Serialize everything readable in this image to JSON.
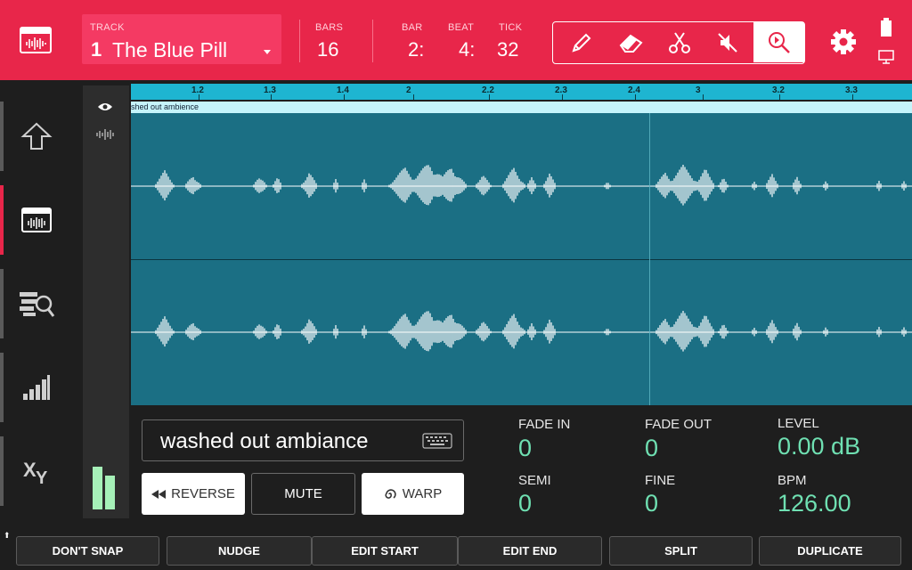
{
  "header": {
    "track_label": "TRACK",
    "track_number": "1",
    "track_name": "The Blue Pill",
    "bars_label": "BARS",
    "bars_value": "16",
    "bar_label": "BAR",
    "bar_value": "2:",
    "beat_label": "BEAT",
    "beat_value": "4:",
    "tick_label": "TICK",
    "tick_value": "32",
    "tools": [
      "pencil-icon",
      "eraser-icon",
      "scissors-icon",
      "mute-icon",
      "zoom-icon"
    ],
    "active_tool": "zoom-icon"
  },
  "sidebar": {
    "items": [
      "up-arrow-icon",
      "audio-edit-icon",
      "browser-search-icon",
      "level-bars-icon",
      "xy-icon"
    ],
    "active": "audio-edit-icon"
  },
  "timeline": {
    "ticks": [
      "1.2",
      "1.3",
      "1.4",
      "2",
      "2.2",
      "2.3",
      "2.4",
      "3",
      "3.2",
      "3.3"
    ],
    "region_label": "shed out ambience"
  },
  "region": {
    "name": "washed out ambiance"
  },
  "buttons": {
    "reverse": "REVERSE",
    "mute": "MUTE",
    "warp": "WARP"
  },
  "params": {
    "fade_in_label": "FADE IN",
    "fade_in_value": "0",
    "fade_out_label": "FADE OUT",
    "fade_out_value": "0",
    "level_label": "LEVEL",
    "level_value": "0.00 dB",
    "semi_label": "SEMI",
    "semi_value": "0",
    "fine_label": "FINE",
    "fine_value": "0",
    "bpm_label": "BPM",
    "bpm_value": "126.00"
  },
  "footer": {
    "dont_snap": "DON'T SNAP",
    "nudge": "NUDGE",
    "edit_start": "EDIT START",
    "edit_end": "EDIT END",
    "split": "SPLIT",
    "duplicate": "DUPLICATE"
  },
  "colors": {
    "topbar": "#e8264a",
    "track_box": "#f43a63",
    "ruler": "#1eb5d1",
    "wave_bg": "#1b6f84",
    "param_value": "#6fe0b2",
    "meter": "#a6f0b8"
  }
}
